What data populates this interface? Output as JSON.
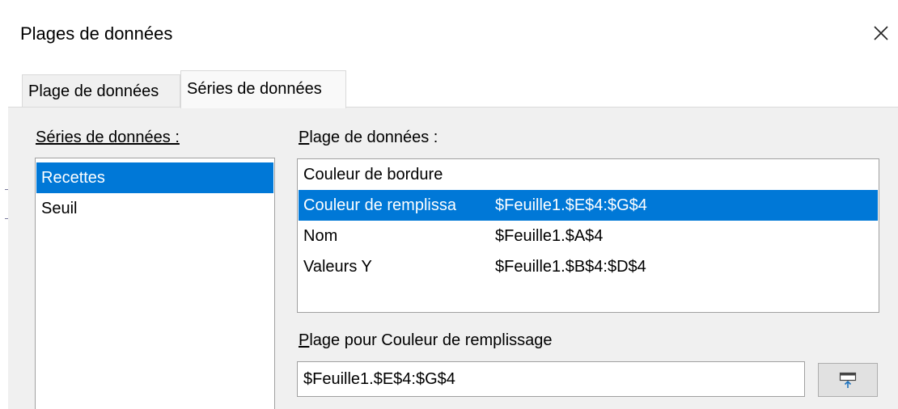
{
  "dialog": {
    "title": "Plages de données"
  },
  "tabs": [
    {
      "label": "Plage de données",
      "active": false
    },
    {
      "label": "Séries de données",
      "active": true
    }
  ],
  "series_panel": {
    "label": "Séries de données :",
    "items": [
      {
        "label": "Recettes",
        "selected": true
      },
      {
        "label": "Seuil",
        "selected": false
      }
    ]
  },
  "range_panel": {
    "label": "Plage de données :",
    "rows": [
      {
        "name": "Couleur de bordure",
        "value": "",
        "selected": false
      },
      {
        "name": "Couleur de remplissa",
        "value": "$Feuille1.$E$4:$G$4",
        "selected": true
      },
      {
        "name": "Nom",
        "value": "$Feuille1.$A$4",
        "selected": false
      },
      {
        "name": "Valeurs Y",
        "value": "$Feuille1.$B$4:$D$4",
        "selected": false
      }
    ]
  },
  "range_for": {
    "label": "Plage pour Couleur de remplissage",
    "value": "$Feuille1.$E$4:$G$4"
  },
  "icons": {
    "close": "close-icon",
    "select_range": "shrink-dialog-icon"
  },
  "colors": {
    "selection": "#0078d7",
    "panel_bg": "#f0f0f0"
  }
}
